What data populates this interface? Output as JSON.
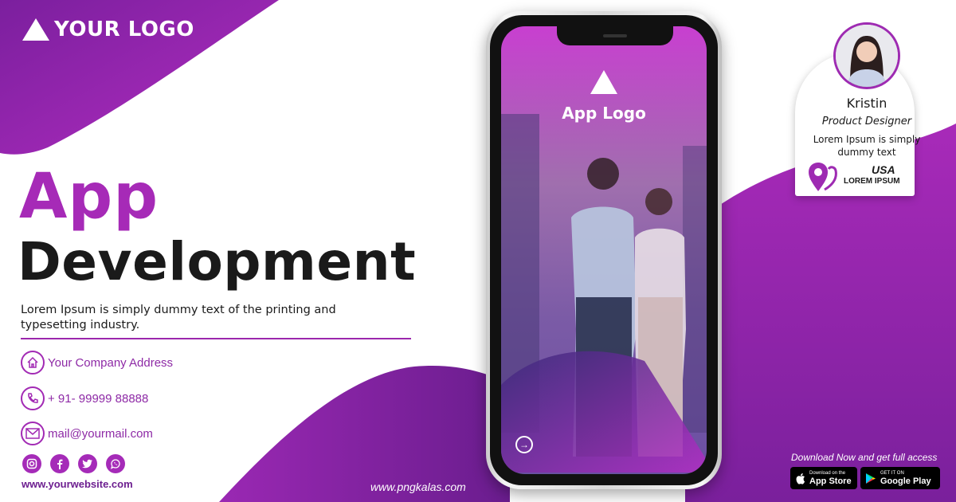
{
  "brand": {
    "logo_text": "YOUR LOGO"
  },
  "headline": {
    "line1": "App",
    "line2": "Development"
  },
  "tagline": "Lorem Ipsum is simply dummy text of the printing and typesetting industry.",
  "contacts": {
    "address": "Your Company Address",
    "phone": "+ 91- 99999 88888",
    "email": "mail@yourmail.com"
  },
  "socials": [
    "instagram-icon",
    "facebook-icon",
    "twitter-icon",
    "whatsapp-icon"
  ],
  "website": "www.yourwebsite.com",
  "credit": "www.pngkalas.com",
  "phone_screen": {
    "app_logo_text": "App Logo"
  },
  "profile": {
    "name": "Kristin",
    "role": "Product Designer",
    "desc": "Lorem Ipsum is simply dummy text",
    "country": "USA",
    "city": "LOREM IPSUM"
  },
  "download": {
    "text": "Download Now and get full access",
    "app_store_small": "Download on the",
    "app_store_big": "App Store",
    "google_small": "GET IT ON",
    "google_big": "Google Play"
  },
  "colors": {
    "accent": "#a62ab7",
    "dark": "#1a1a1a",
    "accent_dark": "#6d1f90"
  }
}
